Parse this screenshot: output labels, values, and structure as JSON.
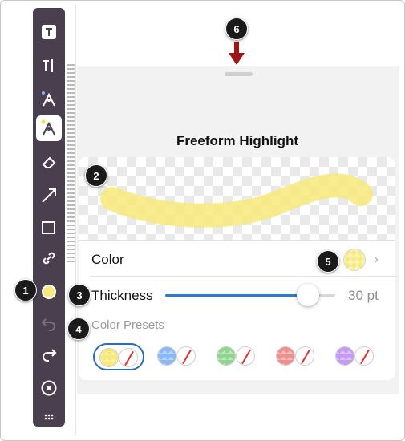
{
  "panel": {
    "title": "Freeform Highlight",
    "color_label": "Color",
    "thickness_label": "Thickness",
    "thickness_value": "30 pt",
    "thickness_level_fraction": 0.84,
    "presets_label": "Color Presets",
    "current_color": "#f7e97b"
  },
  "presets": [
    {
      "color": "#f7e97b",
      "selected": true
    },
    {
      "color": "#8ab8f5",
      "selected": false
    },
    {
      "color": "#8fd58f",
      "selected": false
    },
    {
      "color": "#ef8f8f",
      "selected": false
    },
    {
      "color": "#c49af2",
      "selected": false
    }
  ],
  "toolbar": {
    "tools": [
      "text-box-icon",
      "text-cursor-icon",
      "pen-icon",
      "highlighter-icon",
      "eraser-icon",
      "arrow-icon",
      "rectangle-icon",
      "link-icon",
      "color-icon",
      "undo-icon",
      "redo-icon",
      "close-icon",
      "more-icon"
    ],
    "bg_color": "#4a3f4f"
  },
  "callouts": [
    "1",
    "2",
    "3",
    "4",
    "5",
    "6"
  ],
  "accent": "#2a7bd4"
}
